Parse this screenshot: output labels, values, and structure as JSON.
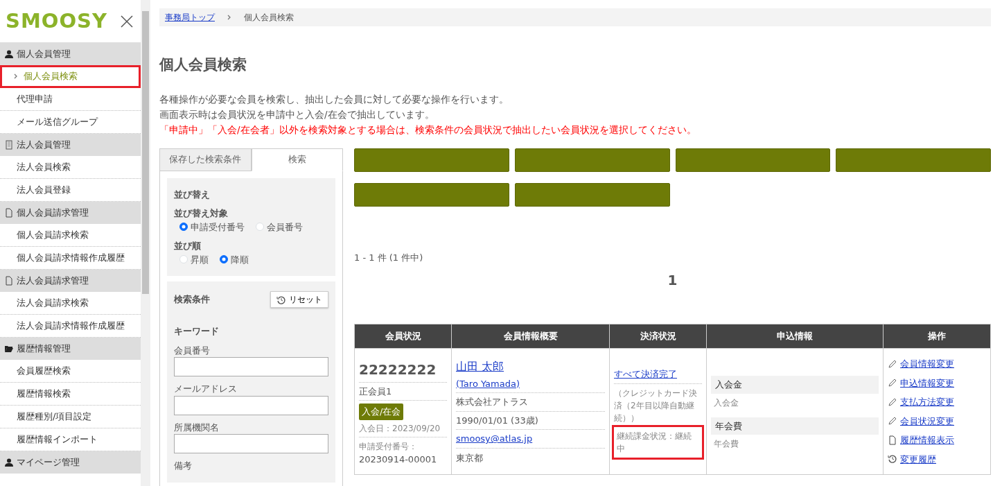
{
  "sidebar": {
    "logo": "SMOOSY",
    "sections": [
      {
        "title": "個人会員管理",
        "kind": "person",
        "items": [
          {
            "label": "個人会員検索",
            "selected": true,
            "highlighted": true
          },
          {
            "label": "代理申請",
            "selected": false,
            "highlighted": false
          },
          {
            "label": "メール送信グループ",
            "selected": false,
            "highlighted": false
          }
        ]
      },
      {
        "title": "法人会員管理",
        "kind": "building",
        "items": [
          {
            "label": "法人会員検索",
            "selected": false,
            "highlighted": false
          },
          {
            "label": "法人会員登録",
            "selected": false,
            "highlighted": false
          }
        ]
      },
      {
        "title": "個人会員請求管理",
        "kind": "document",
        "items": [
          {
            "label": "個人会員請求検索",
            "selected": false,
            "highlighted": false
          },
          {
            "label": "個人会員請求情報作成履歴",
            "selected": false,
            "highlighted": false
          }
        ]
      },
      {
        "title": "法人会員請求管理",
        "kind": "document",
        "items": [
          {
            "label": "法人会員請求検索",
            "selected": false,
            "highlighted": false
          },
          {
            "label": "法人会員請求情報作成履歴",
            "selected": false,
            "highlighted": false
          }
        ]
      },
      {
        "title": "履歴情報管理",
        "kind": "folder",
        "items": [
          {
            "label": "会員履歴検索",
            "selected": false,
            "highlighted": false
          },
          {
            "label": "履歴情報検索",
            "selected": false,
            "highlighted": false
          },
          {
            "label": "履歴種別/項目設定",
            "selected": false,
            "highlighted": false
          },
          {
            "label": "履歴情報インポート",
            "selected": false,
            "highlighted": false
          }
        ]
      },
      {
        "title": "マイページ管理",
        "kind": "person"
      }
    ]
  },
  "breadcrumb": [
    {
      "label": "事務局トップ",
      "link": true
    },
    {
      "label": "個人会員検索",
      "link": false
    }
  ],
  "page_title": "個人会員検索",
  "description": [
    {
      "text": "各種操作が必要な会員を検索し、抽出した会員に対して必要な操作を行います。",
      "kind": "normal"
    },
    {
      "text": "画面表示時は会員状況を申請中と入会/在会で抽出しています。",
      "kind": "normal"
    },
    {
      "text": "「申請中」「入会/在会者」以外を検索対象とする場合は、検索条件の会員状況で抽出したい会員状況を選択してください。",
      "kind": "warning"
    }
  ],
  "search_panel": {
    "tabs": [
      {
        "label": "保存した検索条件",
        "selected": false
      },
      {
        "label": "検索",
        "selected": true
      }
    ],
    "sort": {
      "title": "並び替え",
      "groups": [
        {
          "label": "並び替え対象",
          "options": [
            {
              "label": "申請受付番号",
              "selected": true
            },
            {
              "label": "会員番号",
              "selected": false
            }
          ]
        },
        {
          "label": "並び順",
          "options": [
            {
              "label": "昇順",
              "selected": false
            },
            {
              "label": "降順",
              "selected": true
            }
          ]
        }
      ]
    },
    "conditions": {
      "title": "検索条件",
      "reset": "リセット",
      "keyword_label": "キーワード",
      "fields": [
        {
          "label": "会員番号"
        },
        {
          "label": "メールアドレス"
        },
        {
          "label": "所属機関名"
        }
      ],
      "last_label": "備考"
    }
  },
  "action_buttons": [
    {
      "kind": "blank"
    },
    {
      "kind": "blank"
    },
    {
      "kind": "blank"
    },
    {
      "kind": "blank"
    },
    {
      "kind": "blank"
    },
    {
      "kind": "blank"
    }
  ],
  "pagination": {
    "summary": "1 - 1 件 (1 件中)",
    "pages": [
      {
        "label": "1",
        "selected": true
      }
    ]
  },
  "table": {
    "columns": [
      "会員状況",
      "会員情報概要",
      "決済状況",
      "申込情報",
      "操作"
    ],
    "rows": [
      {
        "member_status": {
          "number": "22222222",
          "type": "正会員1",
          "status": "入会/在会",
          "join_date": "入会日：2023/09/20",
          "receipt_label": "申請受付番号：",
          "receipt_number": "20230914-00001"
        },
        "info": {
          "name": "山田 太郎",
          "name_roman": "(Taro Yamada)",
          "company": "株式会社アトラス",
          "birth": "1990/01/01 (33歳)",
          "email": "smoosy@atlas.jp",
          "prefecture": "東京都"
        },
        "payment": {
          "status": "すべて決済完了",
          "method": "（クレジットカード決済（2年目以降自動継続））",
          "billing": "継続課金状況：継続中",
          "billing_highlighted": true
        },
        "application": [
          {
            "title": "入会金",
            "value": "入会金"
          },
          {
            "title": "年会費",
            "value": "年会費"
          }
        ],
        "operations": [
          {
            "label": "会員情報変更",
            "kind": "pencil"
          },
          {
            "label": "申込情報変更",
            "kind": "pencil"
          },
          {
            "label": "支払方法変更",
            "kind": "pencil"
          },
          {
            "label": "会員状況変更",
            "kind": "pencil"
          },
          {
            "label": "履歴情報表示",
            "kind": "document"
          },
          {
            "label": "変更履歴",
            "kind": "history"
          }
        ]
      }
    ]
  }
}
